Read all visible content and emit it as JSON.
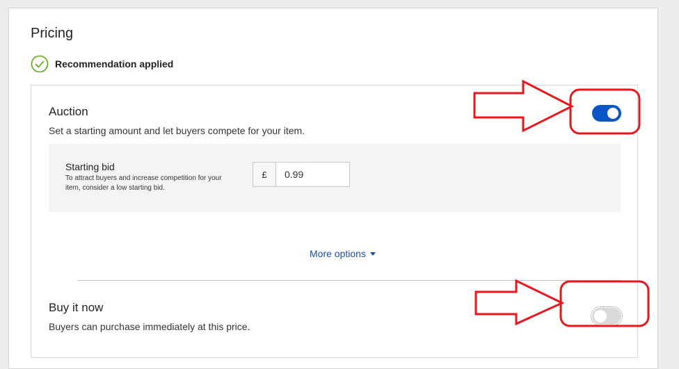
{
  "pricing": {
    "title": "Pricing",
    "recommendation": "Recommendation applied"
  },
  "auction": {
    "title": "Auction",
    "description": "Set a starting amount and let buyers compete for your item.",
    "enabled": true,
    "starting_bid": {
      "label": "Starting bid",
      "hint": "To attract buyers and increase competition for your item, consider a low starting bid.",
      "currency": "£",
      "value": "0.99"
    },
    "more_options": "More options"
  },
  "buy_it_now": {
    "title": "Buy it now",
    "description": "Buyers can purchase immediately at this price.",
    "enabled": false
  },
  "colors": {
    "accent": "#0b55c4",
    "link": "#1f4ea3",
    "annotation": "#e8161d",
    "check": "#5ba80f"
  },
  "icons": [
    "check-circle-icon",
    "caret-down-icon",
    "arrow-annotation-icon"
  ]
}
